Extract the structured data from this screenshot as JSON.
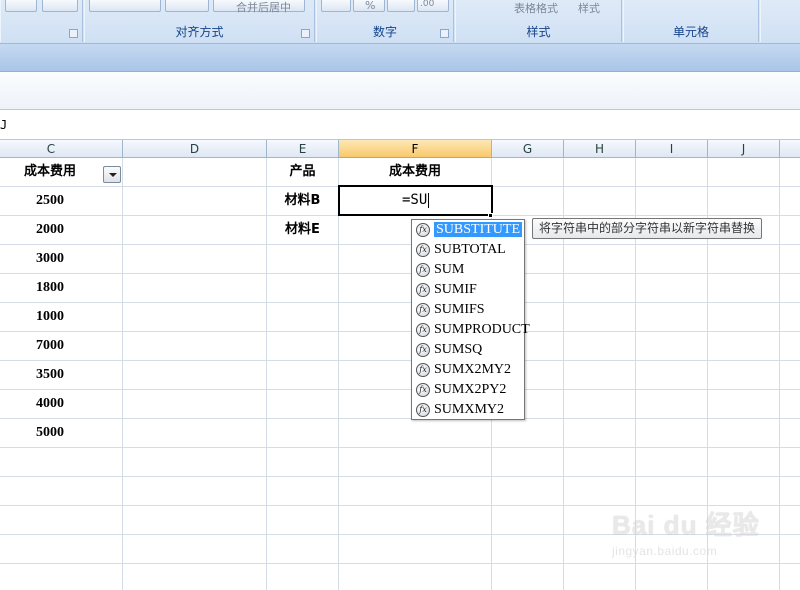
{
  "ribbon": {
    "groups": [
      {
        "label": ""
      },
      {
        "label": "对齐方式"
      },
      {
        "label": "数字"
      },
      {
        "label": "样式"
      },
      {
        "label": "单元格"
      }
    ],
    "partial_texts": {
      "merge_center": "合并后居中",
      "table_format": "表格格式",
      "cell_style": "样式",
      "percent": "%",
      "decimal_increase": ".00",
      "decimal_decrease": "→.0"
    }
  },
  "formula_bar": {
    "content": "J"
  },
  "columns": [
    "C",
    "D",
    "E",
    "F",
    "G",
    "H",
    "I",
    "J"
  ],
  "active_column": "F",
  "sheet": {
    "c_header": "成本费用",
    "c_values": [
      "2500",
      "2000",
      "3000",
      "1800",
      "1000",
      "7000",
      "3500",
      "4000",
      "5000"
    ],
    "e_header": "产品",
    "e_values": [
      "材料B",
      "材料E"
    ],
    "f_header": "成本费用"
  },
  "active_cell": {
    "value": "=SU"
  },
  "autocomplete": {
    "selected_index": 0,
    "items": [
      "SUBSTITUTE",
      "SUBTOTAL",
      "SUM",
      "SUMIF",
      "SUMIFS",
      "SUMPRODUCT",
      "SUMSQ",
      "SUMX2MY2",
      "SUMX2PY2",
      "SUMXMY2"
    ],
    "tooltip": "将字符串中的部分字符串以新字符串替换",
    "icon": "function-icon"
  },
  "watermark": {
    "logo": "Bai du 经验",
    "url": "jingyan.baidu.com"
  }
}
